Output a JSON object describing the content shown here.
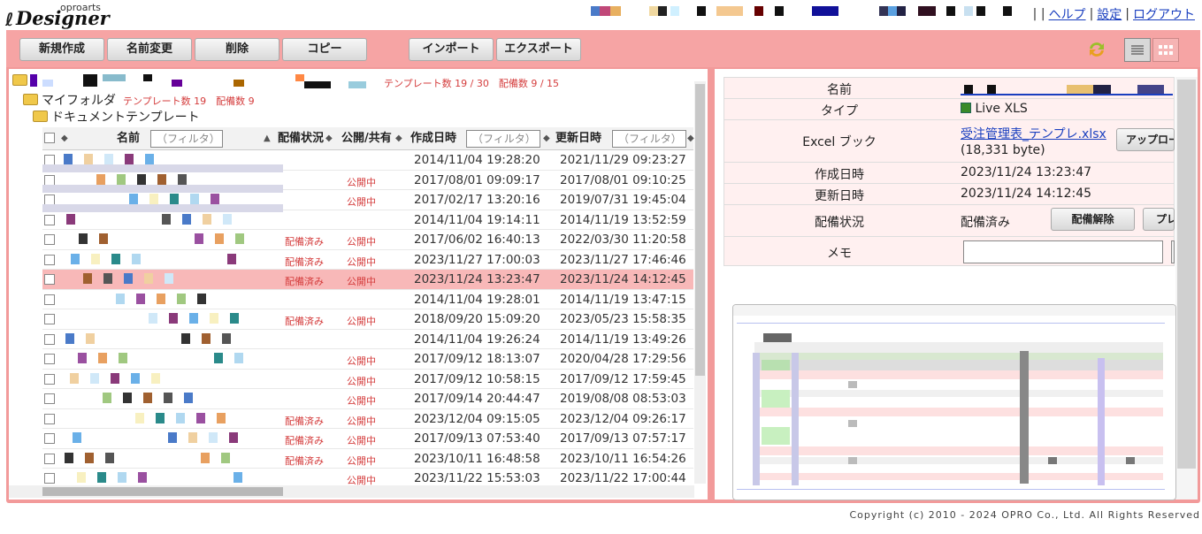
{
  "app": {
    "logo_small": "oproarts",
    "logo_big": "Designer"
  },
  "nav": {
    "sep": "| |",
    "help": "ヘルプ",
    "settings": "設定",
    "logout": "ログアウト"
  },
  "toolbar": {
    "new": "新規作成",
    "rename": "名前変更",
    "delete": "削除",
    "copy": "コピー",
    "import": "インポート",
    "export": "エクスポート"
  },
  "tree": {
    "root_count": "テンプレート数 19 / 30　配備数 9 / 15",
    "myfolder": "マイフォルダ",
    "myfolder_count": "テンプレート数 19　配備数 9",
    "doc": "ドキュメントテンプレート"
  },
  "table": {
    "col_name": "名前",
    "col_deploy": "配備状況",
    "col_public": "公開/共有",
    "col_created": "作成日時",
    "col_updated": "更新日時",
    "filter_placeholder": "（フィルタ）",
    "rows": [
      {
        "deploy": "",
        "public": "",
        "created": "2014/11/04 19:28:20",
        "updated": "2021/11/29 09:23:27",
        "sel": false
      },
      {
        "deploy": "",
        "public": "公開中",
        "created": "2017/08/01 09:09:17",
        "updated": "2017/08/01 09:10:25",
        "sel": false
      },
      {
        "deploy": "",
        "public": "公開中",
        "created": "2017/02/17 13:20:16",
        "updated": "2019/07/31 19:45:04",
        "sel": false
      },
      {
        "deploy": "",
        "public": "",
        "created": "2014/11/04 19:14:11",
        "updated": "2014/11/19 13:52:59",
        "sel": false
      },
      {
        "deploy": "配備済み",
        "public": "公開中",
        "created": "2017/06/02 16:40:13",
        "updated": "2022/03/30 11:20:58",
        "sel": false
      },
      {
        "deploy": "配備済み",
        "public": "公開中",
        "created": "2023/11/27 17:00:03",
        "updated": "2023/11/27 17:46:46",
        "sel": false
      },
      {
        "deploy": "配備済み",
        "public": "公開中",
        "created": "2023/11/24 13:23:47",
        "updated": "2023/11/24 14:12:45",
        "sel": true
      },
      {
        "deploy": "",
        "public": "",
        "created": "2014/11/04 19:28:01",
        "updated": "2014/11/19 13:47:15",
        "sel": false
      },
      {
        "deploy": "配備済み",
        "public": "公開中",
        "created": "2018/09/20 15:09:20",
        "updated": "2023/05/23 15:58:35",
        "sel": false
      },
      {
        "deploy": "",
        "public": "",
        "created": "2014/11/04 19:26:24",
        "updated": "2014/11/19 13:49:26",
        "sel": false
      },
      {
        "deploy": "",
        "public": "公開中",
        "created": "2017/09/12 18:13:07",
        "updated": "2020/04/28 17:29:56",
        "sel": false
      },
      {
        "deploy": "",
        "public": "公開中",
        "created": "2017/09/12 10:58:15",
        "updated": "2017/09/12 17:59:45",
        "sel": false
      },
      {
        "deploy": "",
        "public": "公開中",
        "created": "2017/09/14 20:44:47",
        "updated": "2019/08/08 08:53:03",
        "sel": false
      },
      {
        "deploy": "配備済み",
        "public": "公開中",
        "created": "2023/12/04 09:15:05",
        "updated": "2023/12/04 09:26:17",
        "sel": false
      },
      {
        "deploy": "配備済み",
        "public": "公開中",
        "created": "2017/09/13 07:53:40",
        "updated": "2017/09/13 07:57:17",
        "sel": false
      },
      {
        "deploy": "配備済み",
        "public": "公開中",
        "created": "2023/10/11 16:48:58",
        "updated": "2023/10/11 16:54:26",
        "sel": false
      },
      {
        "deploy": "",
        "public": "公開中",
        "created": "2023/11/22 15:53:03",
        "updated": "2023/11/22 17:00:44",
        "sel": false
      }
    ]
  },
  "detail": {
    "k_name": "名前",
    "k_type": "タイプ",
    "v_type": "Live XLS",
    "k_excel": "Excel ブック",
    "v_excel_link": "受注管理表_テンプレ.xlsx",
    "v_excel_size": "(18,331 byte)",
    "upload": "アップロード",
    "k_created": "作成日時",
    "v_created": "2023/11/24 13:23:47",
    "k_updated": "更新日時",
    "v_updated": "2023/11/24 14:12:45",
    "k_deploy": "配備状況",
    "v_deploy": "配備済み",
    "undeploy": "配備解除",
    "preview": "プレ",
    "k_memo": "メモ"
  },
  "footer": "Copyright (c) 2010 - 2024 OPRO Co., Ltd. All Rights Reserved",
  "colors": {
    "accent": "#f29a9a",
    "link": "#1a3fbf",
    "status": "#d43c3c",
    "selected_row": "#f8b8b8"
  }
}
